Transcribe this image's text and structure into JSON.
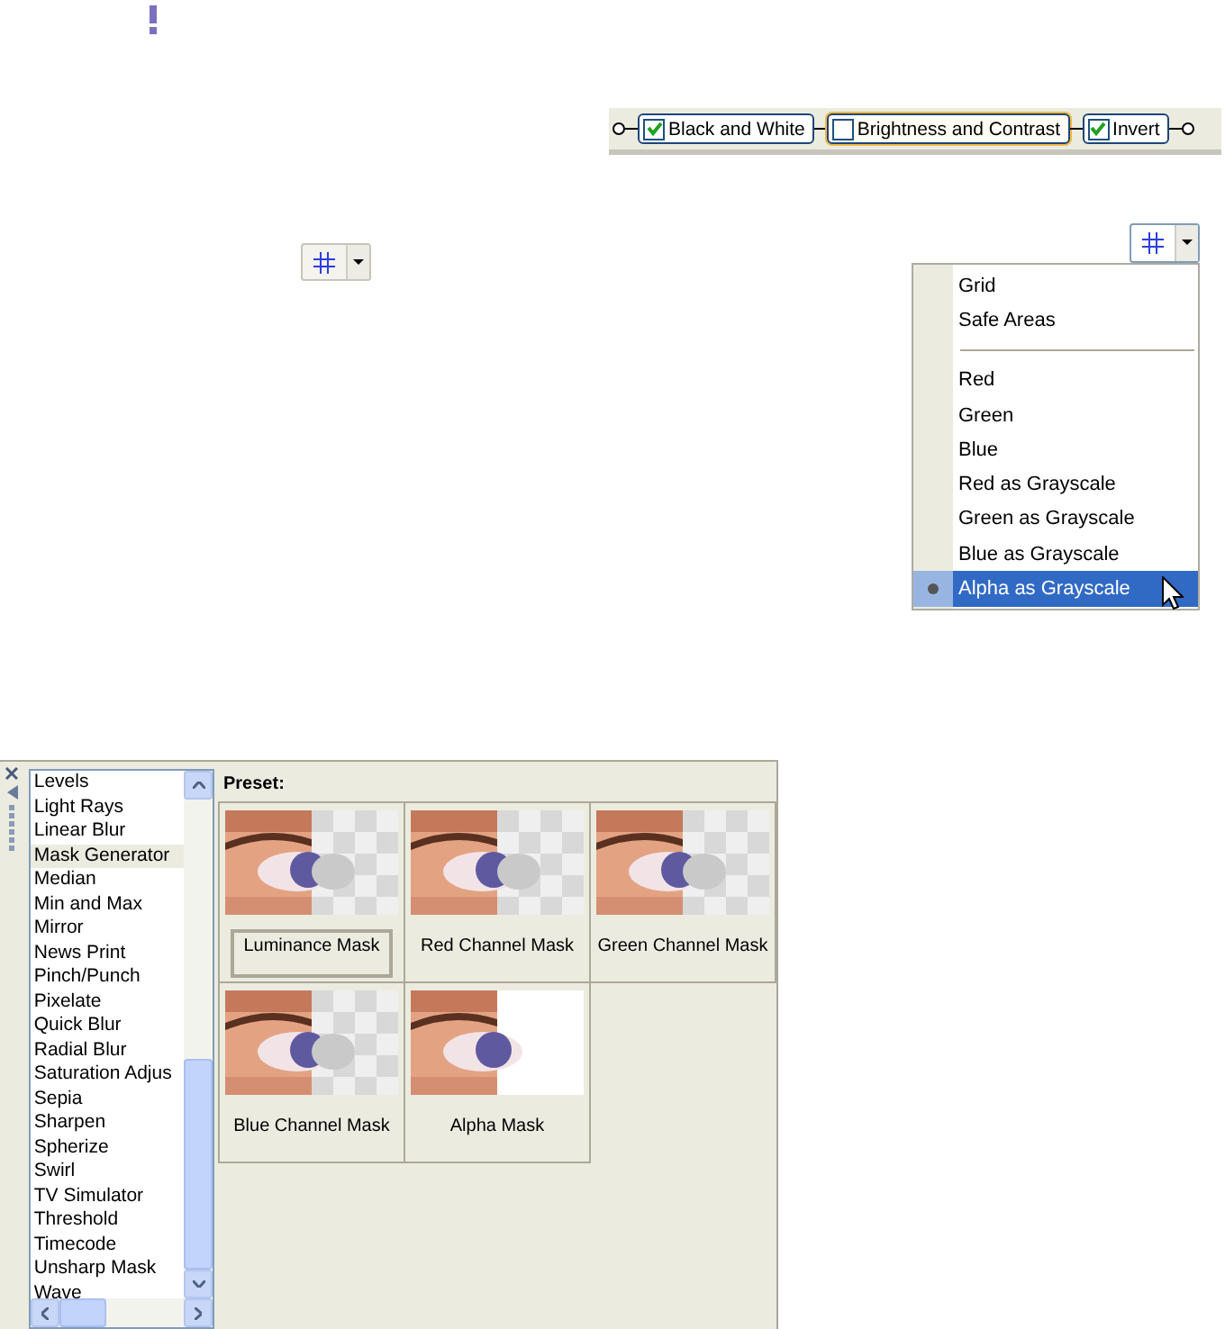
{
  "alert": {
    "kind": "exclamation"
  },
  "effect_chain": [
    {
      "label": "Black and White",
      "checked": true,
      "selected": false
    },
    {
      "label": "Brightness and Contrast",
      "checked": false,
      "selected": true
    },
    {
      "label": "Invert",
      "checked": true,
      "selected": false
    }
  ],
  "grid_menu": {
    "items": [
      {
        "kind": "item",
        "label": "Grid",
        "selected": false
      },
      {
        "kind": "item",
        "label": "Safe Areas",
        "selected": false
      },
      {
        "kind": "separator"
      },
      {
        "kind": "item",
        "label": "Red",
        "selected": false
      },
      {
        "kind": "item",
        "label": "Green",
        "selected": false
      },
      {
        "kind": "item",
        "label": "Blue",
        "selected": false
      },
      {
        "kind": "item",
        "label": "Red as Grayscale",
        "selected": false
      },
      {
        "kind": "item",
        "label": "Green as Grayscale",
        "selected": false
      },
      {
        "kind": "item",
        "label": "Blue as Grayscale",
        "selected": false
      },
      {
        "kind": "item",
        "label": "Alpha as Grayscale",
        "selected": true
      }
    ]
  },
  "effects_panel": {
    "effects": [
      {
        "label": "Levels",
        "selected": false
      },
      {
        "label": "Light Rays",
        "selected": false
      },
      {
        "label": "Linear Blur",
        "selected": false
      },
      {
        "label": "Mask Generator",
        "selected": true
      },
      {
        "label": "Median",
        "selected": false
      },
      {
        "label": "Min and Max",
        "selected": false
      },
      {
        "label": "Mirror",
        "selected": false
      },
      {
        "label": "News Print",
        "selected": false
      },
      {
        "label": "Pinch/Punch",
        "selected": false
      },
      {
        "label": "Pixelate",
        "selected": false
      },
      {
        "label": "Quick Blur",
        "selected": false
      },
      {
        "label": "Radial Blur",
        "selected": false
      },
      {
        "label": "Saturation Adjus",
        "selected": false
      },
      {
        "label": "Sepia",
        "selected": false
      },
      {
        "label": "Sharpen",
        "selected": false
      },
      {
        "label": "Spherize",
        "selected": false
      },
      {
        "label": "Swirl",
        "selected": false
      },
      {
        "label": "TV Simulator",
        "selected": false
      },
      {
        "label": "Threshold",
        "selected": false
      },
      {
        "label": "Timecode",
        "selected": false
      },
      {
        "label": "Unsharp Mask",
        "selected": false
      },
      {
        "label": "Wave",
        "selected": false
      }
    ],
    "preset_label": "Preset:",
    "presets": [
      {
        "label": "Luminance Mask",
        "selected": true
      },
      {
        "label": "Red Channel Mask",
        "selected": false
      },
      {
        "label": "Green Channel Mask",
        "selected": false
      },
      {
        "label": "Blue Channel Mask",
        "selected": false
      },
      {
        "label": "Alpha Mask",
        "selected": false
      }
    ]
  }
}
